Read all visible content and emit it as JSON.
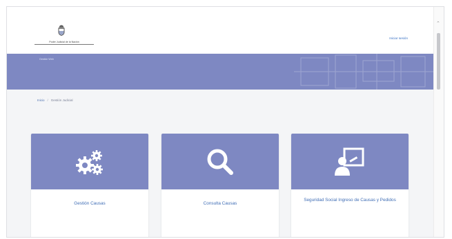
{
  "header": {
    "org_name": "Poder Judicial de la Nación",
    "login_link": "Iniciar sesión",
    "emblem": "coat-of-arms-icon"
  },
  "hero": {
    "title": "Gestión Web"
  },
  "breadcrumb": {
    "home": "Inicio",
    "current": "Gestión Judicial"
  },
  "cards": [
    {
      "label": "Gestión Causas",
      "icon": "gears-icon"
    },
    {
      "label": "Consulta Causas",
      "icon": "search-icon"
    },
    {
      "label": "Seguridad Social Ingreso de Causas y Pedidos",
      "icon": "presentation-icon"
    }
  ],
  "colors": {
    "accent": "#7e88c2",
    "link": "#3f6db5",
    "background": "#f4f5f7"
  }
}
